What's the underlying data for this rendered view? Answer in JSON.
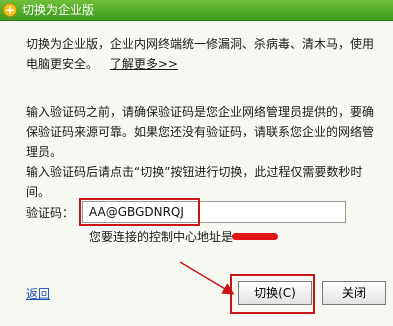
{
  "window": {
    "title": "切换为企业版",
    "icon": "add-icon"
  },
  "intro": {
    "text": "切换为企业版，企业内网终端统一修漏洞、杀病毒、清木马，使用电脑更安全。",
    "learn_more": "了解更多>>"
  },
  "instructions": {
    "line1": "输入验证码之前，请确保验证码是您企业网络管理员提供的，要确保验证码来源可靠。如果您还没有验证码，请联系您企业的网络管理员。",
    "line2": "输入验证码后请点击“切换”按钮进行切换，此过程仅需要数秒时间。"
  },
  "verification": {
    "label": "验证码：",
    "value": "AA@GBGDNRQJ",
    "center_label": "您要连接的控制中心地址是"
  },
  "footer": {
    "back": "返回",
    "switch_label": "切换",
    "switch_shortcut": "(C)",
    "close_label": "关闭"
  },
  "colors": {
    "titlebar": "#4aa625",
    "annotation": "#c81414"
  }
}
